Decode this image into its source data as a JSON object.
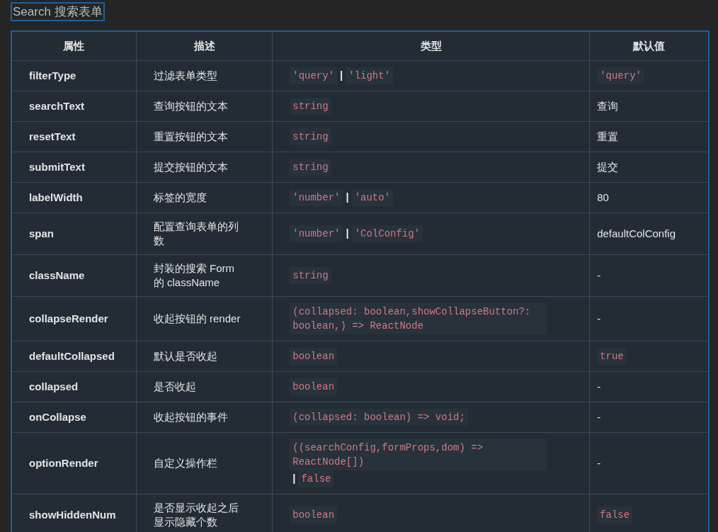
{
  "heading": "Search 搜索表单",
  "table": {
    "columns": [
      "属性",
      "描述",
      "类型",
      "默认值"
    ],
    "rows": [
      {
        "name": "filterType",
        "description": "过滤表单类型",
        "type": [
          {
            "kind": "code",
            "text": "'query'"
          },
          {
            "kind": "sep",
            "text": "|"
          },
          {
            "kind": "code",
            "text": "'light'"
          }
        ],
        "default": [
          {
            "kind": "code",
            "text": "'query'"
          }
        ]
      },
      {
        "name": "searchText",
        "description": "查询按钮的文本",
        "type": [
          {
            "kind": "code",
            "text": "string"
          }
        ],
        "default": [
          {
            "kind": "text",
            "text": "查询"
          }
        ]
      },
      {
        "name": "resetText",
        "description": "重置按钮的文本",
        "type": [
          {
            "kind": "code",
            "text": "string"
          }
        ],
        "default": [
          {
            "kind": "text",
            "text": "重置"
          }
        ]
      },
      {
        "name": "submitText",
        "description": "提交按钮的文本",
        "type": [
          {
            "kind": "code",
            "text": "string"
          }
        ],
        "default": [
          {
            "kind": "text",
            "text": "提交"
          }
        ]
      },
      {
        "name": "labelWidth",
        "description": "标签的宽度",
        "type": [
          {
            "kind": "code",
            "text": "'number'"
          },
          {
            "kind": "sep",
            "text": "|"
          },
          {
            "kind": "code",
            "text": "'auto'"
          }
        ],
        "default": [
          {
            "kind": "text",
            "text": "80"
          }
        ]
      },
      {
        "name": "span",
        "description": "配置查询表单的列数",
        "type": [
          {
            "kind": "code",
            "text": "'number'"
          },
          {
            "kind": "sep",
            "text": "|"
          },
          {
            "kind": "code",
            "text": "'ColConfig'"
          }
        ],
        "default": [
          {
            "kind": "text",
            "text": "defaultColConfig"
          }
        ]
      },
      {
        "name": "className",
        "description": "封装的搜索 Form 的 className",
        "type": [
          {
            "kind": "code",
            "text": "string"
          }
        ],
        "default": [
          {
            "kind": "text",
            "text": "-"
          }
        ]
      },
      {
        "name": "collapseRender",
        "description": "收起按钮的 render",
        "type": [
          {
            "kind": "code",
            "text": "(collapsed: boolean,showCollapseButton?: boolean,) => ReactNode"
          }
        ],
        "default": [
          {
            "kind": "text",
            "text": "-"
          }
        ]
      },
      {
        "name": "defaultCollapsed",
        "description": "默认是否收起",
        "type": [
          {
            "kind": "code",
            "text": "boolean"
          }
        ],
        "default": [
          {
            "kind": "code",
            "text": "true"
          }
        ]
      },
      {
        "name": "collapsed",
        "description": "是否收起",
        "type": [
          {
            "kind": "code",
            "text": "boolean"
          }
        ],
        "default": [
          {
            "kind": "text",
            "text": "-"
          }
        ]
      },
      {
        "name": "onCollapse",
        "description": "收起按钮的事件",
        "type": [
          {
            "kind": "code",
            "text": "(collapsed: boolean) => void;"
          }
        ],
        "default": [
          {
            "kind": "text",
            "text": "-"
          }
        ]
      },
      {
        "name": "optionRender",
        "description": "自定义操作栏",
        "type": [
          {
            "kind": "code",
            "text": "((searchConfig,formProps,dom) => ReactNode[])"
          },
          {
            "kind": "sep",
            "text": "|"
          },
          {
            "kind": "code",
            "text": "false"
          }
        ],
        "default": [
          {
            "kind": "text",
            "text": "-"
          }
        ]
      },
      {
        "name": "showHiddenNum",
        "description": "是否显示收起之后显示隐藏个数",
        "type": [
          {
            "kind": "code",
            "text": "boolean"
          }
        ],
        "default": [
          {
            "kind": "code",
            "text": "false"
          }
        ]
      }
    ]
  }
}
